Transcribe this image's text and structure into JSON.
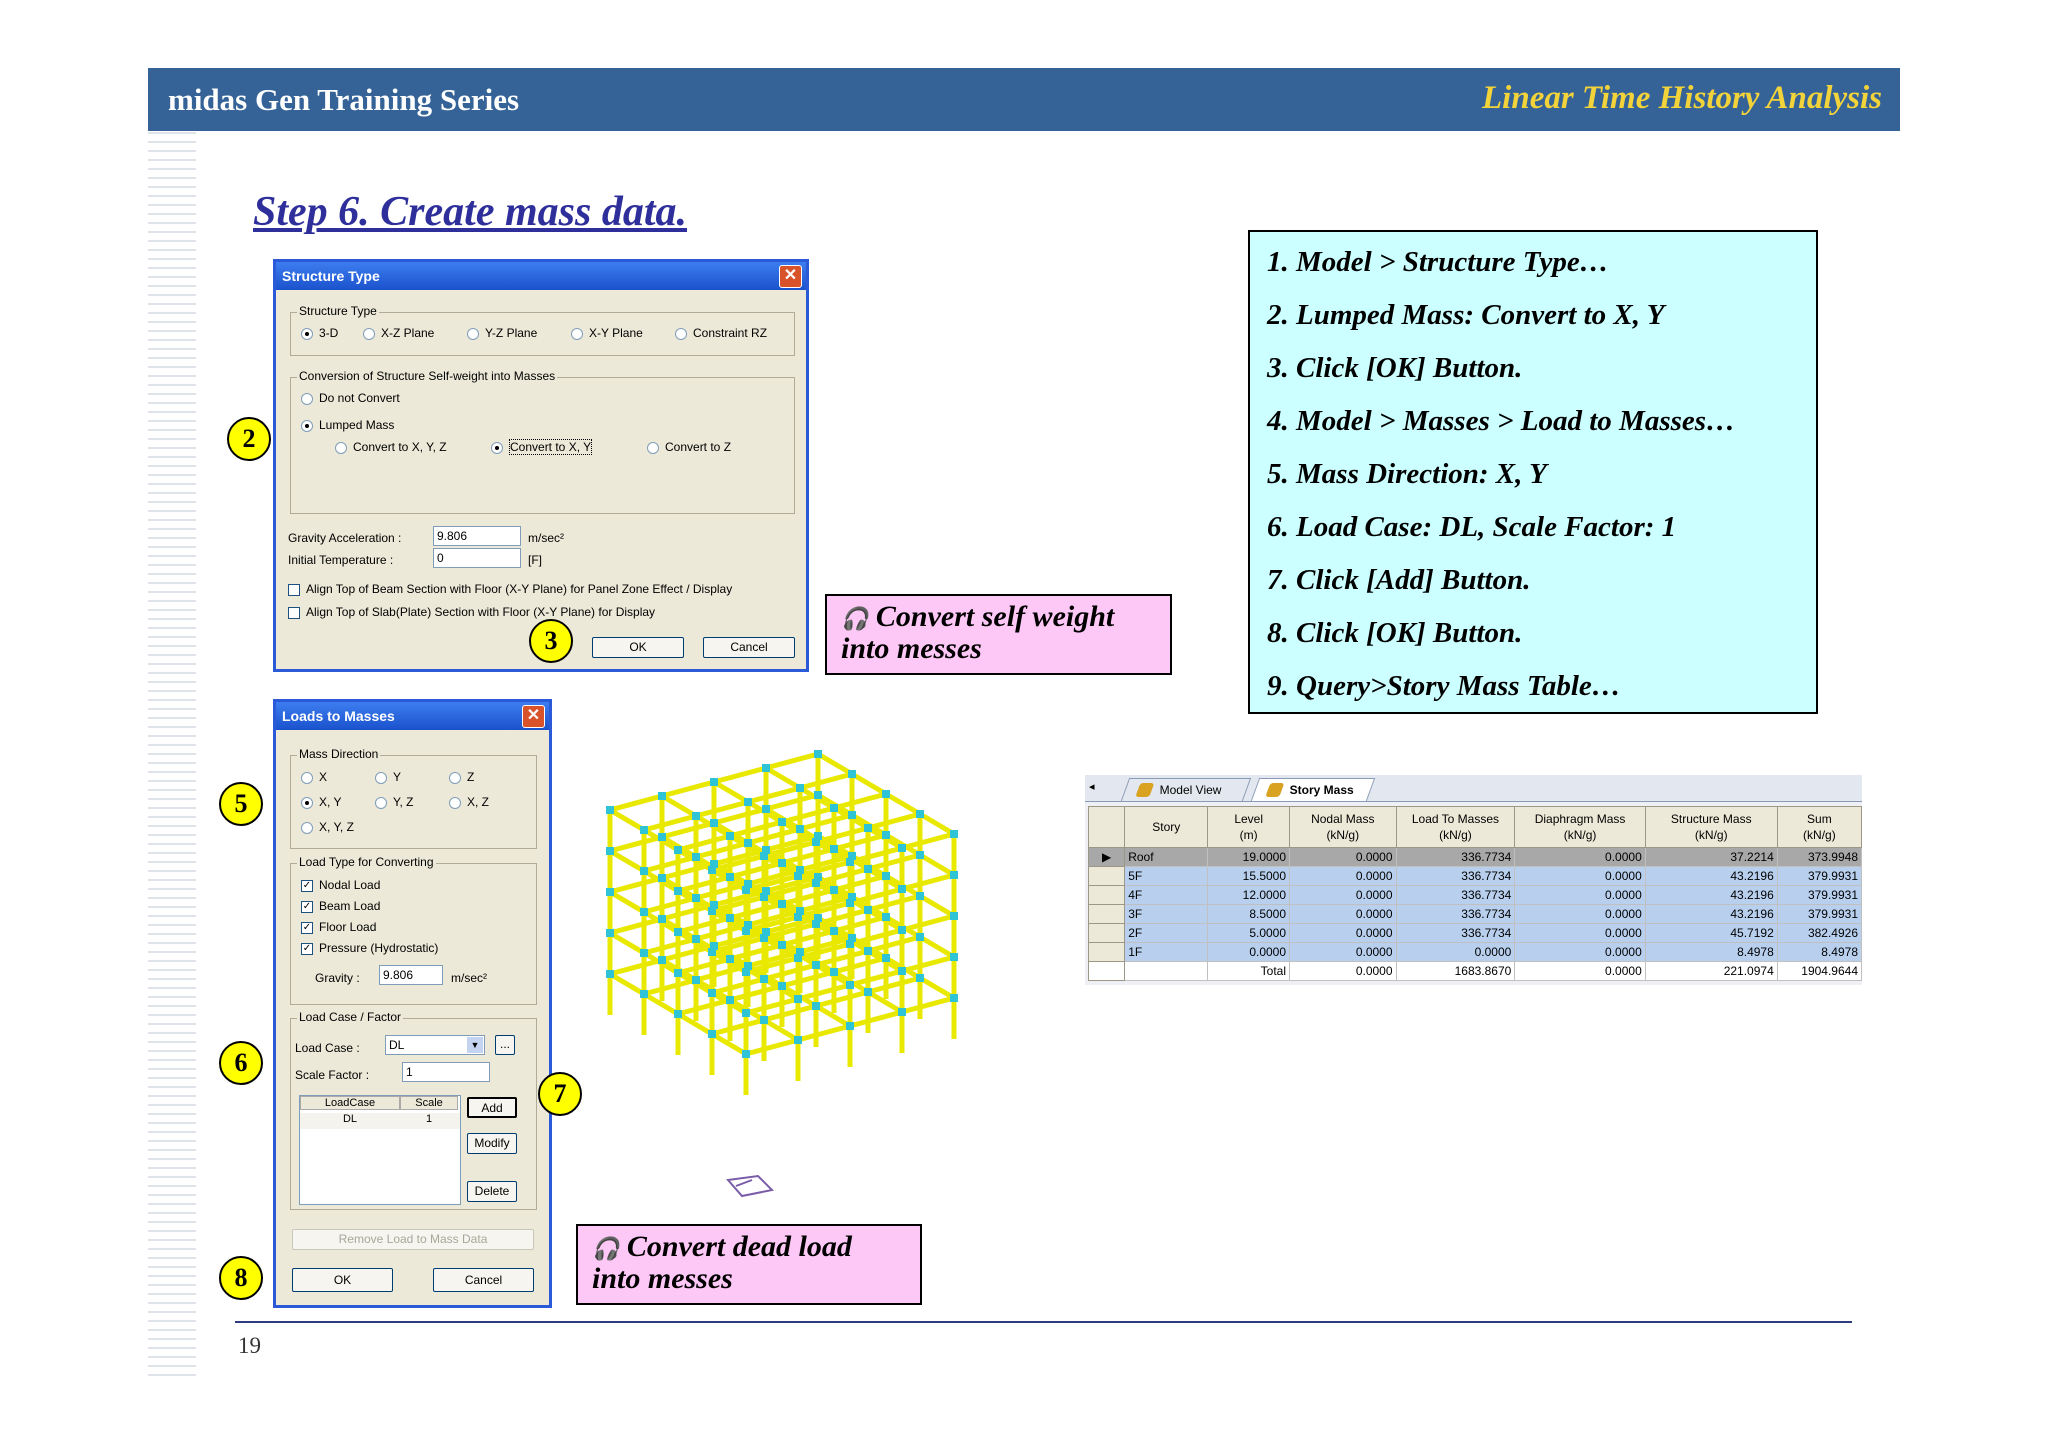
{
  "header": {
    "series": "midas Gen Training Series",
    "topic": "Linear Time History Analysis"
  },
  "step_title": "Step 6. Create mass data.",
  "page_number": "19",
  "structure_type_dialog": {
    "title": "Structure Type",
    "close": "✕",
    "structure_type_group": "Structure Type",
    "structure_options": [
      "3-D",
      "X-Z Plane",
      "Y-Z Plane",
      "X-Y Plane",
      "Constraint RZ"
    ],
    "conversion_group": "Conversion of Structure Self-weight into Masses",
    "do_not_convert": "Do not Convert",
    "lumped_mass": "Lumped Mass",
    "convert_options": [
      "Convert to X, Y, Z",
      "Convert to X, Y",
      "Convert to Z"
    ],
    "gravity_label": "Gravity Acceleration :",
    "gravity_value": "9.806",
    "gravity_unit": "m/sec²",
    "temperature_label": "Initial Temperature :",
    "temperature_value": "0",
    "temperature_unit": "[F]",
    "align_beam": "Align Top of Beam Section with Floor (X-Y Plane) for Panel Zone Effect / Display",
    "align_slab": "Align Top of Slab(Plate) Section with Floor (X-Y Plane) for Display",
    "ok": "OK",
    "cancel": "Cancel"
  },
  "loads_to_masses_dialog": {
    "title": "Loads to Masses",
    "close": "✕",
    "mass_direction_group": "Mass Direction",
    "directions": [
      "X",
      "Y",
      "Z",
      "X, Y",
      "Y, Z",
      "X, Z",
      "X, Y, Z"
    ],
    "load_type_group": "Load Type for Converting",
    "load_types": [
      "Nodal Load",
      "Beam Load",
      "Floor Load",
      "Pressure (Hydrostatic)"
    ],
    "gravity_label": "Gravity :",
    "gravity_value": "9.806",
    "gravity_unit": "m/sec²",
    "load_case_group": "Load Case / Factor",
    "load_case_label": "Load Case :",
    "load_case_value": "DL",
    "browse": "...",
    "scale_factor_label": "Scale Factor :",
    "scale_factor_value": "1",
    "list_headers": [
      "LoadCase",
      "Scale"
    ],
    "list_row": {
      "case": "DL",
      "scale": "1"
    },
    "add": "Add",
    "modify": "Modify",
    "delete": "Delete",
    "remove": "Remove Load to Mass Data",
    "ok": "OK",
    "cancel": "Cancel"
  },
  "callouts": [
    "2",
    "3",
    "5",
    "6",
    "7",
    "8"
  ],
  "notes": {
    "self_weight": [
      "Convert self weight",
      "into messes"
    ],
    "dead_load": [
      "Convert dead load",
      "into messes"
    ],
    "icon": "🎧"
  },
  "instructions": [
    "1. Model > Structure Type…",
    "2. Lumped Mass: Convert to X, Y",
    "3. Click [OK] Button.",
    "4. Model > Masses > Load to Masses…",
    "5. Mass Direction: X, Y",
    "6. Load Case: DL, Scale Factor: 1",
    "7. Click [Add] Button.",
    "8. Click [OK] Button.",
    "9. Query>Story Mass Table…"
  ],
  "story_mass_table": {
    "tabs": [
      "Model View",
      "Story Mass"
    ],
    "headers": [
      "Story",
      "Level\n(m)",
      "Nodal Mass\n(kN/g)",
      "Load To Masses\n(kN/g)",
      "Diaphragm Mass\n(kN/g)",
      "Structure Mass\n(kN/g)",
      "Sum\n(kN/g)"
    ],
    "rows": [
      [
        "Roof",
        "19.0000",
        "0.0000",
        "336.7734",
        "0.0000",
        "37.2214",
        "373.9948"
      ],
      [
        "5F",
        "15.5000",
        "0.0000",
        "336.7734",
        "0.0000",
        "43.2196",
        "379.9931"
      ],
      [
        "4F",
        "12.0000",
        "0.0000",
        "336.7734",
        "0.0000",
        "43.2196",
        "379.9931"
      ],
      [
        "3F",
        "8.5000",
        "0.0000",
        "336.7734",
        "0.0000",
        "43.2196",
        "379.9931"
      ],
      [
        "2F",
        "5.0000",
        "0.0000",
        "336.7734",
        "0.0000",
        "45.7192",
        "382.4926"
      ],
      [
        "1F",
        "0.0000",
        "0.0000",
        "0.0000",
        "0.0000",
        "8.4978",
        "8.4978"
      ]
    ],
    "total": [
      "",
      "Total",
      "0.0000",
      "1683.8670",
      "0.0000",
      "221.0974",
      "1904.9644"
    ]
  },
  "colors": {
    "header_bg": "#356397",
    "topic": "#f2d33a",
    "step_title": "#2e2f9b",
    "callout": "#ffff00",
    "note_bg": "#fdc8f6",
    "instructions_bg": "#ccffff",
    "frame": "#e8e800"
  }
}
